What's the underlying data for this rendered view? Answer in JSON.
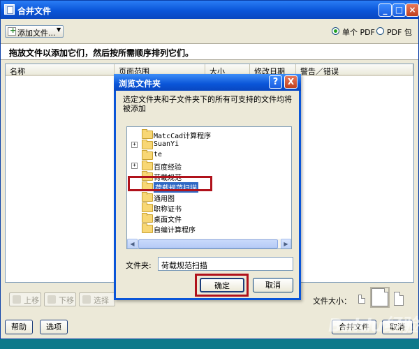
{
  "window": {
    "title": "合并文件"
  },
  "toolbar": {
    "add_files_label": "添加文件..."
  },
  "output": {
    "single_pdf_label": "单个 PDF",
    "pdf_package_label": "PDF 包",
    "selected": "single_pdf"
  },
  "instruction": "拖放文件以添加它们，然后按所需顺序排列它们。",
  "columns": [
    "名称",
    "页面范围",
    "大小",
    "修改日期",
    "警告／错误"
  ],
  "list_buttons": {
    "up": "上移",
    "down": "下移",
    "select_pages": "选择页面"
  },
  "file_size_label": "文件大小：",
  "bottom": {
    "help": "帮助",
    "options": "选项",
    "cancel": "取消",
    "merge_partial": "合并文件"
  },
  "dialog": {
    "title": "浏览文件夹",
    "description": "选定文件夹和子文件夹下的所有可支持的文件均将被添加",
    "tree_items": [
      {
        "label": "MatcCad计算程序",
        "expander": "",
        "selected": false
      },
      {
        "label": "SuanYi",
        "expander": "+",
        "selected": false
      },
      {
        "label": "te",
        "expander": "",
        "selected": false
      },
      {
        "label": "百度经验",
        "expander": "+",
        "selected": false
      },
      {
        "label": "荷载规范",
        "expander": "",
        "selected": false
      },
      {
        "label": "荷载规范扫描",
        "expander": "",
        "selected": true
      },
      {
        "label": "通用图",
        "expander": "",
        "selected": false
      },
      {
        "label": "职称证书",
        "expander": "",
        "selected": false
      },
      {
        "label": "桌面文件",
        "expander": "",
        "selected": false
      },
      {
        "label": "自编计算程序",
        "expander": "",
        "selected": false
      }
    ],
    "folder_label": "文件夹:",
    "folder_value": "荷载规范扫描",
    "ok_label": "确定",
    "cancel_label": "取消",
    "help_glyph": "?",
    "close_glyph": "X"
  },
  "watermark": "Baidu经验",
  "colors": {
    "title_bar": "#0a55d8",
    "highlight": "#316ac5",
    "red_box": "#b0121b",
    "window_bg": "#ece9d8"
  }
}
